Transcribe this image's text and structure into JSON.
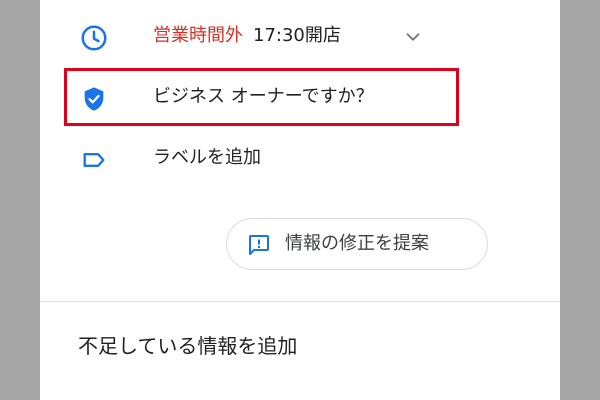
{
  "colors": {
    "accent": "#1a73e8",
    "closed_status": "#d93025",
    "highlight_border": "#e0001b",
    "text": "#202124"
  },
  "hours": {
    "icon": "clock-icon",
    "status": "営業時間外",
    "opens": "17:30開店",
    "expand_icon": "chevron-down-icon"
  },
  "owner": {
    "icon": "verified-shield-icon",
    "label": "ビジネス オーナーですか？"
  },
  "label_row": {
    "icon": "label-tag-icon",
    "label": "ラベルを追加"
  },
  "suggest_edit": {
    "icon": "feedback-icon",
    "label": "情報の修正を提案"
  },
  "missing_info": {
    "label": "不足している情報を追加"
  }
}
